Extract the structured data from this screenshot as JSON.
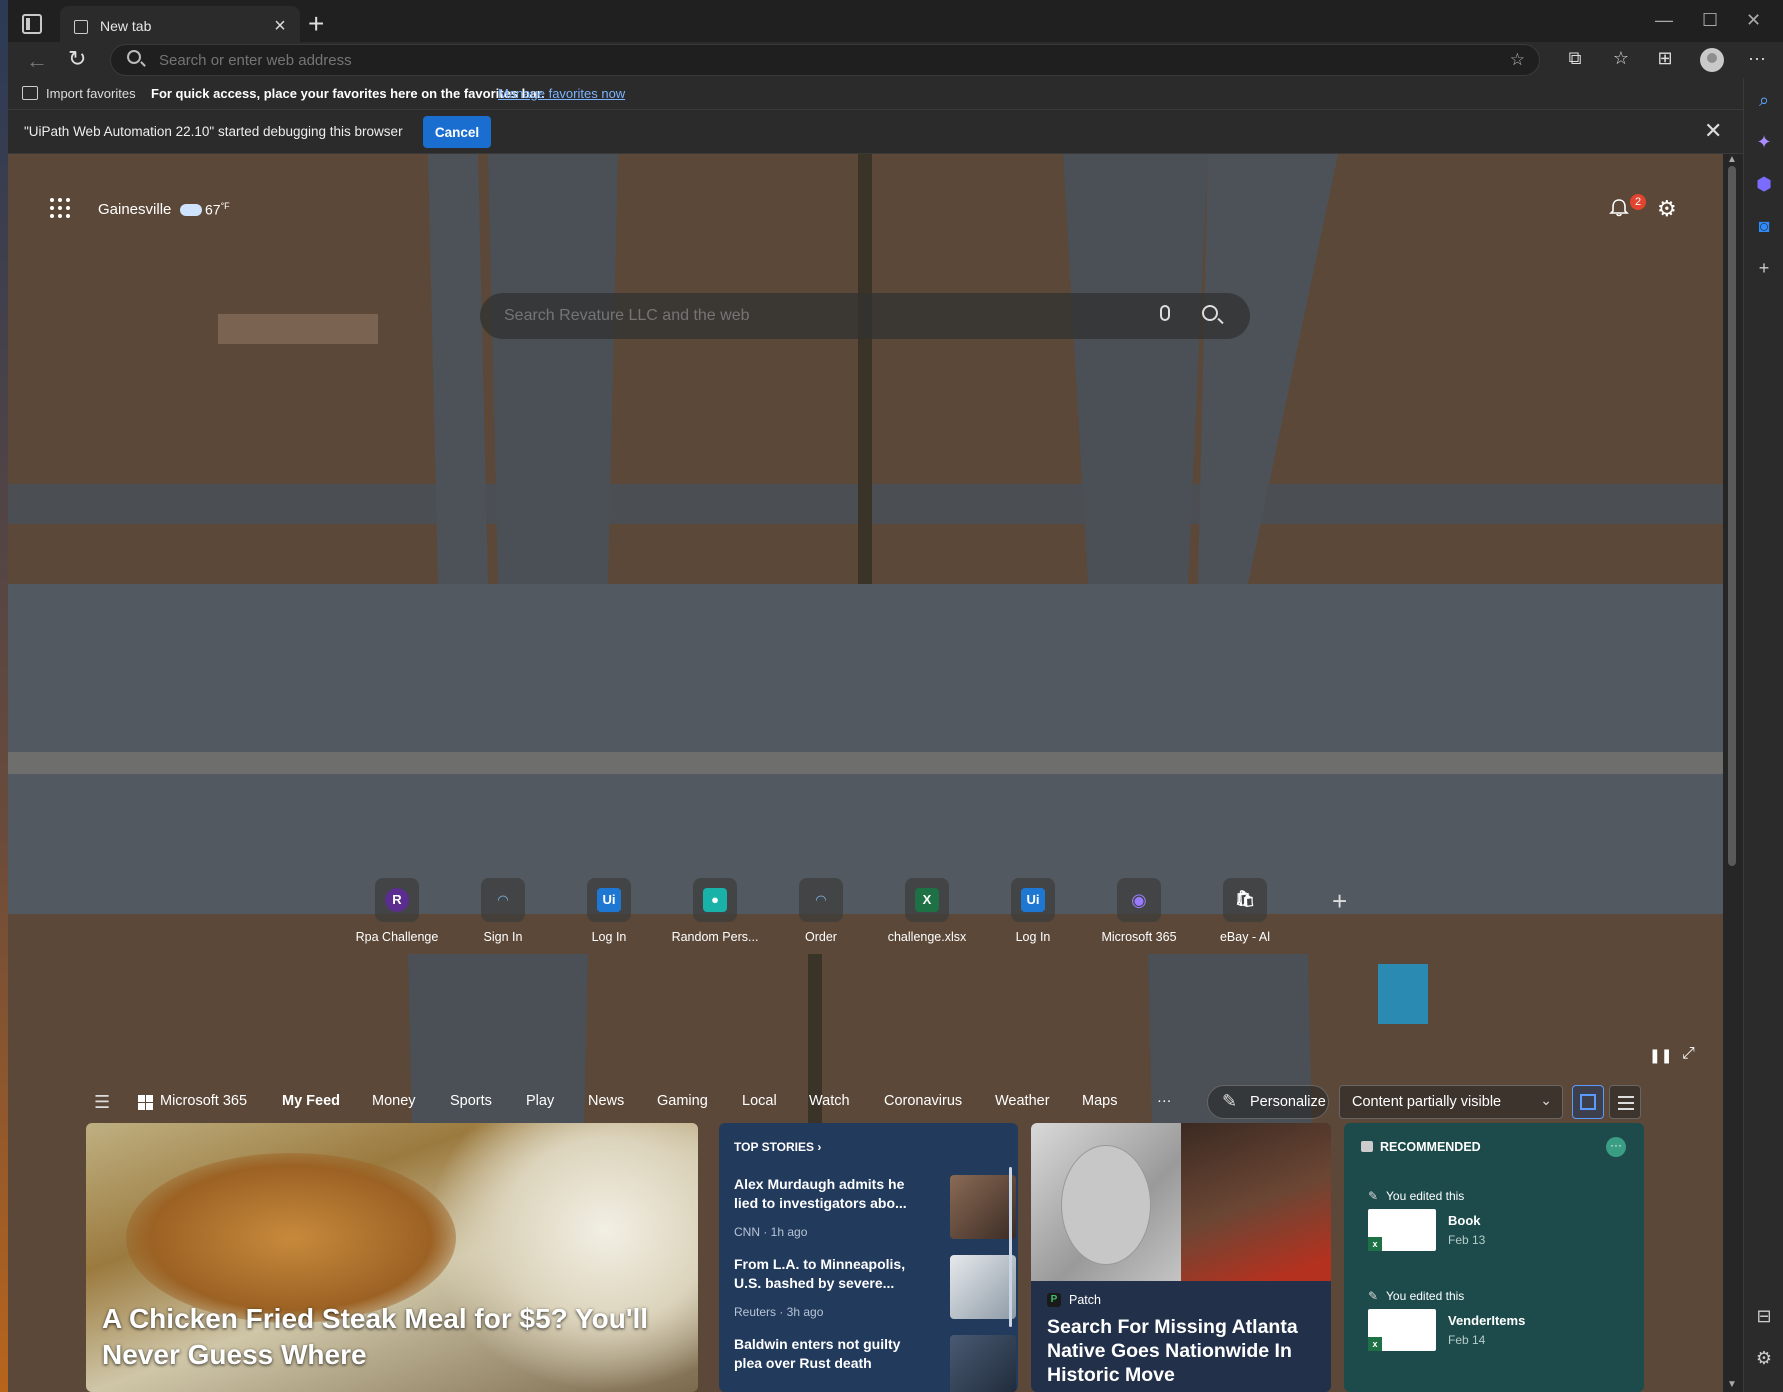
{
  "browser": {
    "tab_title": "New tab",
    "address_placeholder": "Search or enter web address"
  },
  "favorites_bar": {
    "import_label": "Import favorites",
    "message": "For quick access, place your favorites here on the favorites bar.",
    "link": "Manage favorites now"
  },
  "infobar": {
    "message": "\"UiPath Web Automation 22.10\" started debugging this browser",
    "cancel_label": "Cancel"
  },
  "weather": {
    "location": "Gainesville",
    "temperature": "67",
    "unit": "°F"
  },
  "notifications": {
    "count": "2"
  },
  "search": {
    "placeholder": "Search Revature LLC and the web"
  },
  "speed_dials": [
    {
      "label": "Rpa Challenge",
      "glyph": "R",
      "color": "#5b2d8e",
      "icon": "rpa-challenge-icon"
    },
    {
      "label": "Sign In",
      "glyph": "◠",
      "color": "#2a2a2a",
      "icon": "sign-in-icon"
    },
    {
      "label": "Log In",
      "glyph": "Ui",
      "color": "#1f77d4",
      "icon": "uipath-icon"
    },
    {
      "label": "Random Pers...",
      "glyph": "●",
      "color": "#18b2a8",
      "icon": "random-person-icon"
    },
    {
      "label": "Order",
      "glyph": "◠",
      "color": "#2a2a2a",
      "icon": "order-icon"
    },
    {
      "label": "challenge.xlsx",
      "glyph": "X",
      "color": "#1e7145",
      "icon": "excel-icon"
    },
    {
      "label": "Log In",
      "glyph": "Ui",
      "color": "#1f77d4",
      "icon": "uipath-icon"
    },
    {
      "label": "Microsoft 365",
      "glyph": "◉",
      "color": "#6a4bd6",
      "icon": "microsoft-365-icon"
    },
    {
      "label": "eBay - Al",
      "glyph": "🛍",
      "color": "#333333",
      "icon": "ebay-icon"
    }
  ],
  "feed_nav": {
    "m365": "Microsoft 365",
    "items": [
      "My Feed",
      "Money",
      "Sports",
      "Play",
      "News",
      "Gaming",
      "Local",
      "Watch",
      "Coronavirus",
      "Weather",
      "Maps",
      "···"
    ],
    "personalize": "Personalize",
    "content_visibility": "Content partially visible"
  },
  "hero": {
    "title": "A Chicken Fried Steak Meal for $5? You'll Never Guess Where"
  },
  "top_stories": {
    "header": "TOP STORIES ›",
    "items": [
      {
        "title": "Alex Murdaugh admits he lied to investigators abo...",
        "meta": "CNN · 1h ago"
      },
      {
        "title": "From L.A. to Minneapolis, U.S. bashed by severe...",
        "meta": "Reuters · 3h ago"
      },
      {
        "title": "Baldwin enters not guilty plea over Rust death",
        "meta": ""
      }
    ]
  },
  "patch_card": {
    "source": "Patch",
    "source_glyph": "P",
    "title": "Search For Missing Atlanta Native Goes Nationwide In Historic Move"
  },
  "recommended": {
    "header": "RECOMMENDED",
    "more": "···",
    "items": [
      {
        "edited": "You edited this",
        "name": "Book",
        "date": "Feb 13"
      },
      {
        "edited": "You edited this",
        "name": "VenderItems",
        "date": "Feb 14"
      }
    ]
  },
  "colors": {
    "accent": "#1a6ed0",
    "link": "#7cb4ff",
    "top_stories_bg": "#223a5c",
    "recommended_bg": "#1d4b4c"
  }
}
